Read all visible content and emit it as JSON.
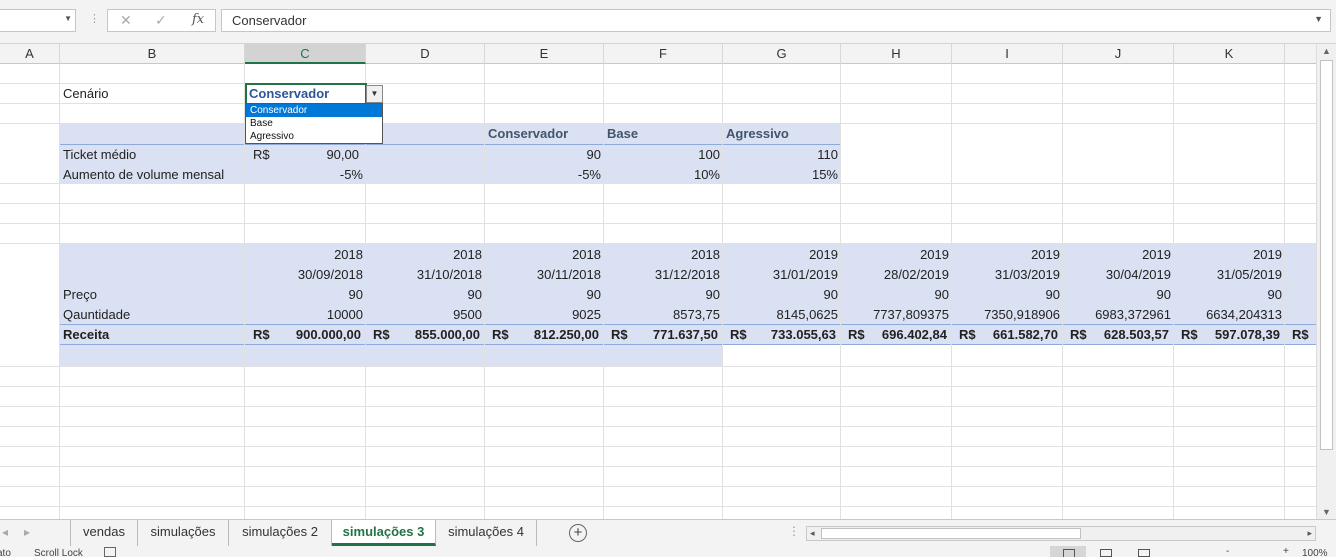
{
  "formula_bar": {
    "name_box_value": "",
    "formula_value": "Conservador"
  },
  "columns": [
    "A",
    "B",
    "C",
    "D",
    "E",
    "F",
    "G",
    "H",
    "I",
    "J",
    "K"
  ],
  "cells": {
    "cenario_label": "Cenário",
    "selected_value": "Conservador",
    "dropdown_options": [
      "Conservador",
      "Base",
      "Agressivo"
    ],
    "scenario_headers": [
      "Conservador",
      "Base",
      "Agressivo"
    ],
    "ticket": {
      "label": "Ticket médio",
      "currency": "R$",
      "value": "90,00",
      "values": [
        "90",
        "100",
        "110"
      ]
    },
    "aumento": {
      "label": "Aumento de volume mensal",
      "value": "-5%",
      "values": [
        "-5%",
        "10%",
        "15%"
      ]
    },
    "years": [
      "2018",
      "2018",
      "2018",
      "2018",
      "2019",
      "2019",
      "2019",
      "2019",
      "2019"
    ],
    "dates": [
      "30/09/2018",
      "31/10/2018",
      "30/11/2018",
      "31/12/2018",
      "31/01/2019",
      "28/02/2019",
      "31/03/2019",
      "30/04/2019",
      "31/05/2019"
    ],
    "preco": {
      "label": "Preço",
      "values": [
        "90",
        "90",
        "90",
        "90",
        "90",
        "90",
        "90",
        "90",
        "90"
      ]
    },
    "quantidade": {
      "label": "Qauntidade",
      "values": [
        "10000",
        "9500",
        "9025",
        "8573,75",
        "8145,0625",
        "7737,809375",
        "7350,918906",
        "6983,372961",
        "6634,204313"
      ]
    },
    "receita": {
      "label": "Receita",
      "currency": "R$",
      "values": [
        "900.000,00",
        "855.000,00",
        "812.250,00",
        "771.637,50",
        "733.055,63",
        "696.402,84",
        "661.582,70",
        "628.503,57",
        "597.078,39"
      ]
    }
  },
  "sheet_tabs": [
    "vendas",
    "simulações",
    "simulações 2",
    "simulações 3",
    "simulações 4"
  ],
  "active_tab": "simulações 3",
  "status": {
    "left_fragment": "ato",
    "scroll_lock": "Scroll Lock",
    "zoom_minus": "-",
    "zoom_plus": "+",
    "zoom": "100%"
  }
}
